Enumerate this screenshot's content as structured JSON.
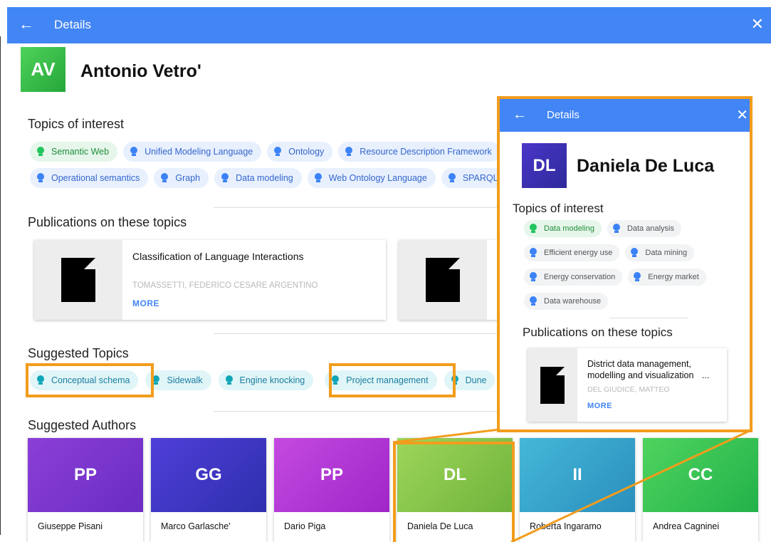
{
  "main": {
    "header": {
      "back_icon": "←",
      "title": "Details",
      "close_icon": "✕"
    },
    "profile": {
      "initials": "AV",
      "name": "Antonio Vetro'"
    },
    "topics_title": "Topics of interest",
    "topics_row1": [
      "Semantic Web",
      "Unified Modeling Language",
      "Ontology",
      "Resource Description Framework"
    ],
    "topics_row2": [
      "Operational semantics",
      "Graph",
      "Data modeling",
      "Web Ontology Language",
      "SPARQL"
    ],
    "publications_title": "Publications on these topics",
    "publications": [
      {
        "title": "Classification of Language Interactions",
        "authors": "TOMASSETTI, FEDERICO CESARE ARGENTINO",
        "more": "MORE"
      },
      {
        "title": "",
        "authors": "",
        "more": ""
      }
    ],
    "suggested_topics_title": "Suggested Topics",
    "suggested_topics": [
      "Conceptual schema",
      "Sidewalk",
      "Engine knocking",
      "Project management",
      "Dune"
    ],
    "suggested_authors_title": "Suggested Authors",
    "suggested_authors": [
      {
        "initials": "PP",
        "name": "Giuseppe Pisani",
        "color1": "#8b3fd6",
        "color2": "#6a2cc4"
      },
      {
        "initials": "GG",
        "name": "Marco Garlasche'",
        "color1": "#4f3fd8",
        "color2": "#2f2fae"
      },
      {
        "initials": "PP",
        "name": "Dario Piga",
        "color1": "#c34ae0",
        "color2": "#a026c8"
      },
      {
        "initials": "DL",
        "name": "Daniela De Luca",
        "color1": "#9ed65a",
        "color2": "#6fb33c"
      },
      {
        "initials": "II",
        "name": "Roberta Ingaramo",
        "color1": "#45b7d8",
        "color2": "#2a8fbd"
      },
      {
        "initials": "CC",
        "name": "Andrea Cagninei",
        "color1": "#4fd35e",
        "color2": "#22b24a"
      }
    ]
  },
  "popup": {
    "header": {
      "back_icon": "←",
      "title": "Details",
      "close_icon": "✕"
    },
    "profile": {
      "initials": "DL",
      "name": "Daniela De Luca"
    },
    "topics_title": "Topics of interest",
    "topics": [
      [
        "Data modeling",
        "Data analysis"
      ],
      [
        "Efficient energy use",
        "Data mining"
      ],
      [
        "Energy conservation",
        "Energy market"
      ],
      [
        "Data warehouse"
      ]
    ],
    "publications_title": "Publications on these topics",
    "publication": {
      "title_line1": "District data management,",
      "title_line2": "modelling and visualization",
      "ellipsis": "...",
      "authors": "DEL GIUDICE, MATTEO",
      "more": "MORE"
    }
  },
  "colors": {
    "header": "#4285f4",
    "highlight": "#f29c1c"
  }
}
